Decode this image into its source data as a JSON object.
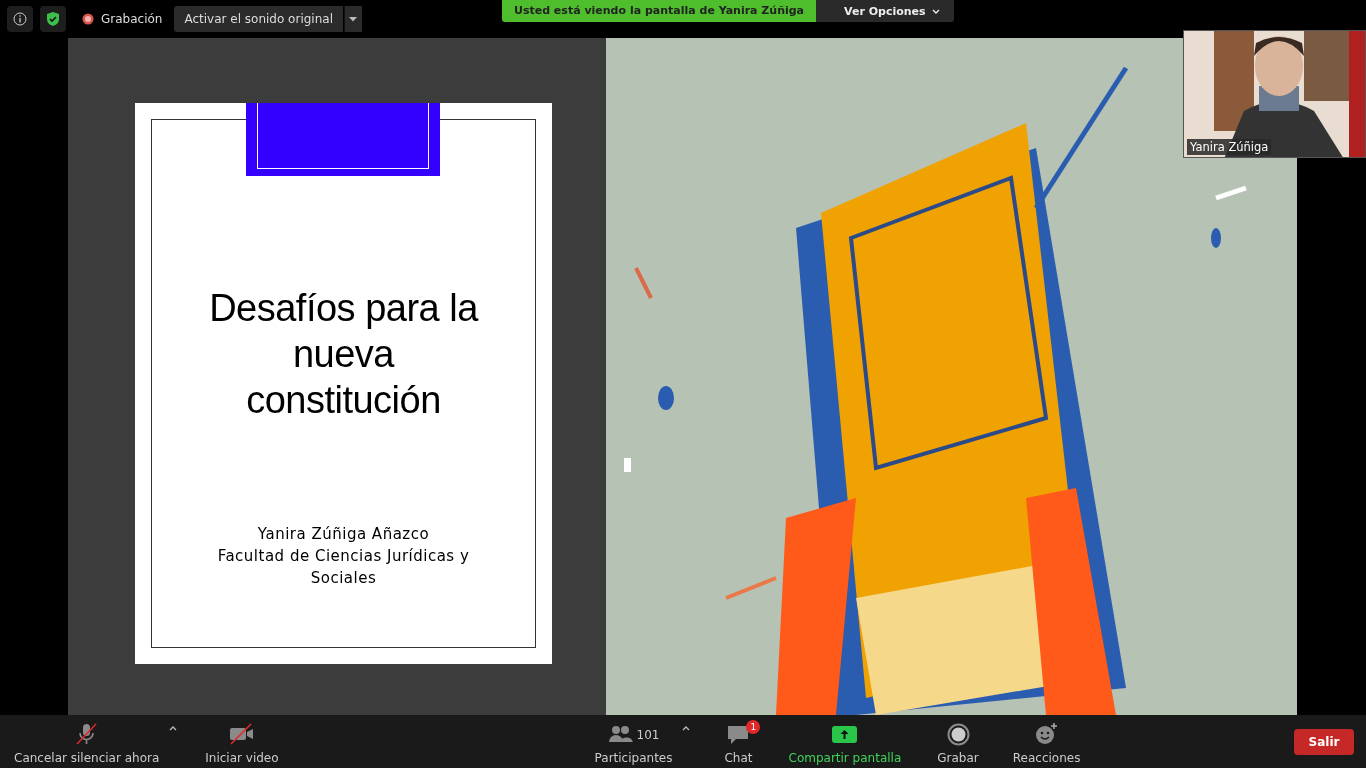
{
  "top_bar": {
    "recording_label": "Grabación",
    "audio_button": "Activar el sonido original",
    "share_banner": "Usted está viendo la pantalla de Yanira Zúñiga",
    "view_options": "Ver Opciones"
  },
  "slide": {
    "title_lines": [
      "Desafíos para la",
      "nueva",
      "constitución"
    ],
    "author": "Yanira Zúñiga Añazco",
    "affiliation_lines": [
      "Facultad de Ciencias Jurídicas y",
      "Sociales"
    ]
  },
  "video_thumbnail": {
    "name": "Yanira Zúñiga"
  },
  "toolbar": {
    "items": [
      {
        "kind": "mic",
        "label": "Cancelar silenciar ahora",
        "off": true,
        "caret": true
      },
      {
        "kind": "video",
        "label": "Iniciar video",
        "off": true,
        "caret": false
      },
      {
        "kind": "participants",
        "label": "Participantes",
        "count": "101",
        "caret": true
      },
      {
        "kind": "chat",
        "label": "Chat",
        "badge": "1"
      },
      {
        "kind": "share",
        "label": "Compartir pantalla"
      },
      {
        "kind": "record",
        "label": "Grabar"
      },
      {
        "kind": "reactions",
        "label": "Reacciones"
      }
    ],
    "leave_button": "Salir"
  }
}
